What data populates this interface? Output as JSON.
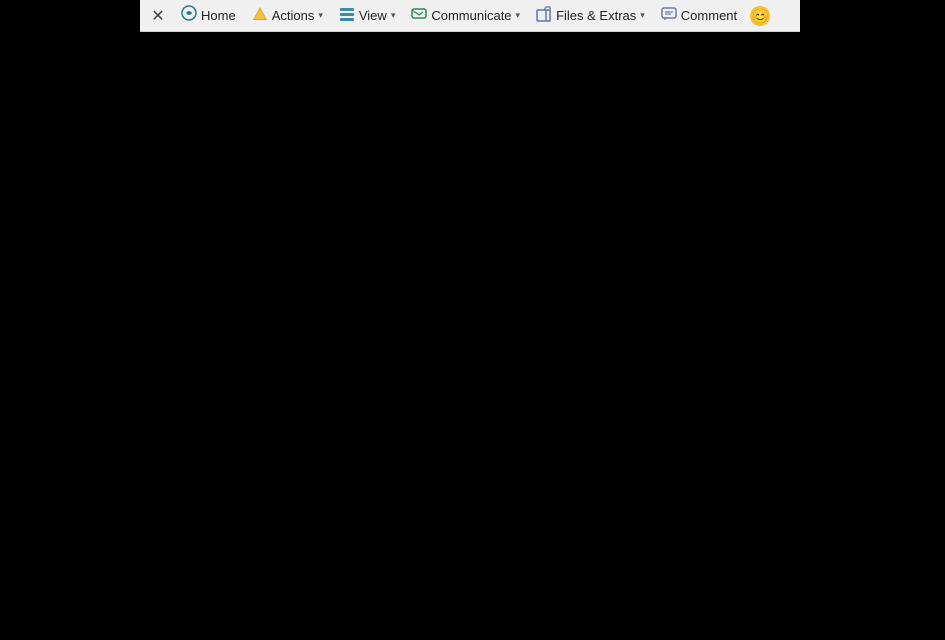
{
  "toolbar": {
    "close_label": "✕",
    "home_label": "Home",
    "actions_label": "Actions",
    "view_label": "View",
    "communicate_label": "Communicate",
    "files_extras_label": "Files & Extras",
    "comment_label": "Comment",
    "chevron": "▾"
  },
  "mini_toolbar": {
    "grid_icon": "⊞",
    "resize_icon": "⤢",
    "collapse_icon": "▲"
  },
  "main": {
    "background": "#000000"
  }
}
